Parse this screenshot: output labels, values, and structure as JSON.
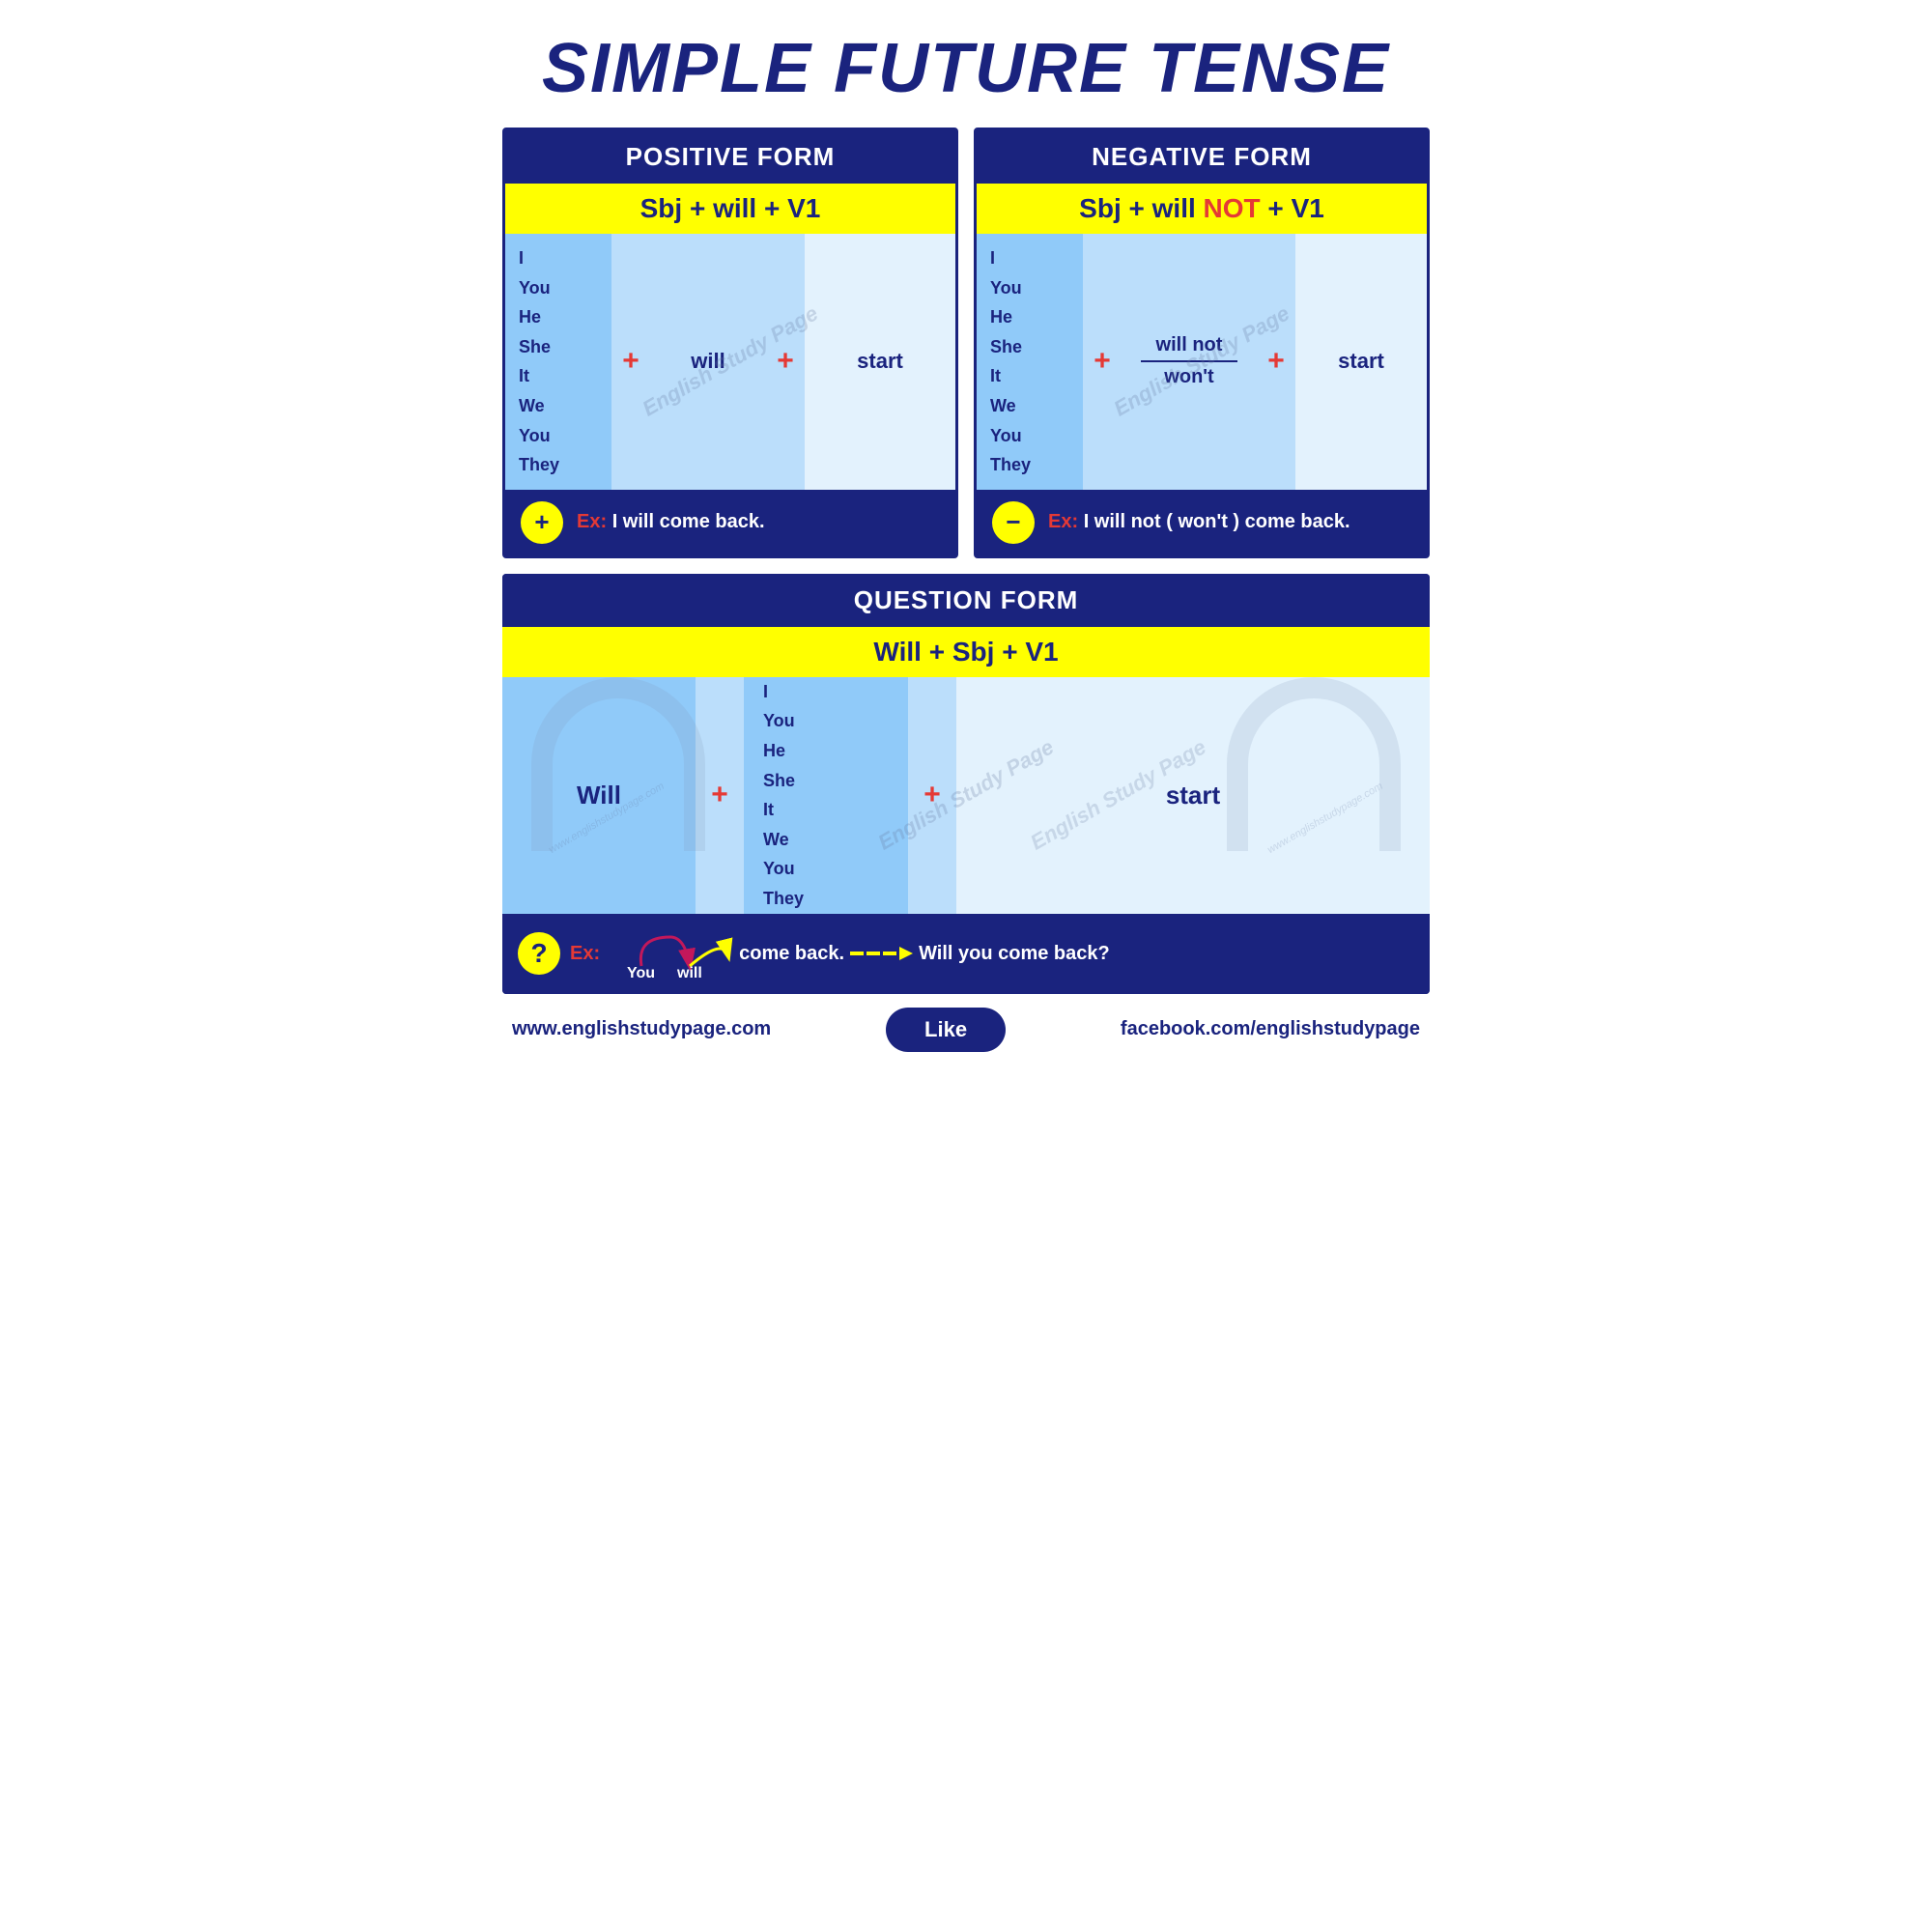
{
  "title": "SIMPLE FUTURE TENSE",
  "positive": {
    "header": "POSITIVE FORM",
    "formula": "Sbj + will + V1",
    "subjects": [
      "I",
      "You",
      "He",
      "She",
      "It",
      "We",
      "You",
      "They"
    ],
    "plus1": "+",
    "will": "will",
    "plus2": "+",
    "verb": "start",
    "watermark": "English Study Page",
    "example_icon": "+",
    "example_label": "Ex:",
    "example_text": "I will come back."
  },
  "negative": {
    "header": "NEGATIVE FORM",
    "formula_base": "Sbj + will ",
    "formula_not": "NOT",
    "formula_end": " + V1",
    "subjects": [
      "I",
      "You",
      "He",
      "She",
      "It",
      "We",
      "You",
      "They"
    ],
    "plus1": "+",
    "will_not_top": "will not",
    "will_not_bottom": "won't",
    "plus2": "+",
    "verb": "start",
    "watermark": "English Study Page",
    "example_icon": "−",
    "example_label": "Ex:",
    "example_text": "I will not ( won't ) come back."
  },
  "question": {
    "header": "QUESTION FORM",
    "formula": "Will +  Sbj + V1",
    "will": "Will",
    "subjects": [
      "I",
      "You",
      "He",
      "She",
      "It",
      "We",
      "You",
      "They"
    ],
    "plus1": "+",
    "plus2": "+",
    "verb": "start",
    "watermark1": "English Study Page",
    "watermark2": "English Study Page",
    "watermark3": "www.englishstudypage.com",
    "watermark4": "www.englishstudypage.com",
    "example_icon": "?",
    "example_label": "Ex:",
    "you_label": "You",
    "will_label": "will",
    "come_back": "come back.",
    "result_text": "Will you come back?"
  },
  "footer": {
    "left": "www.englishstudypage.com",
    "like": "Like",
    "right": "facebook.com/englishstudypage"
  }
}
